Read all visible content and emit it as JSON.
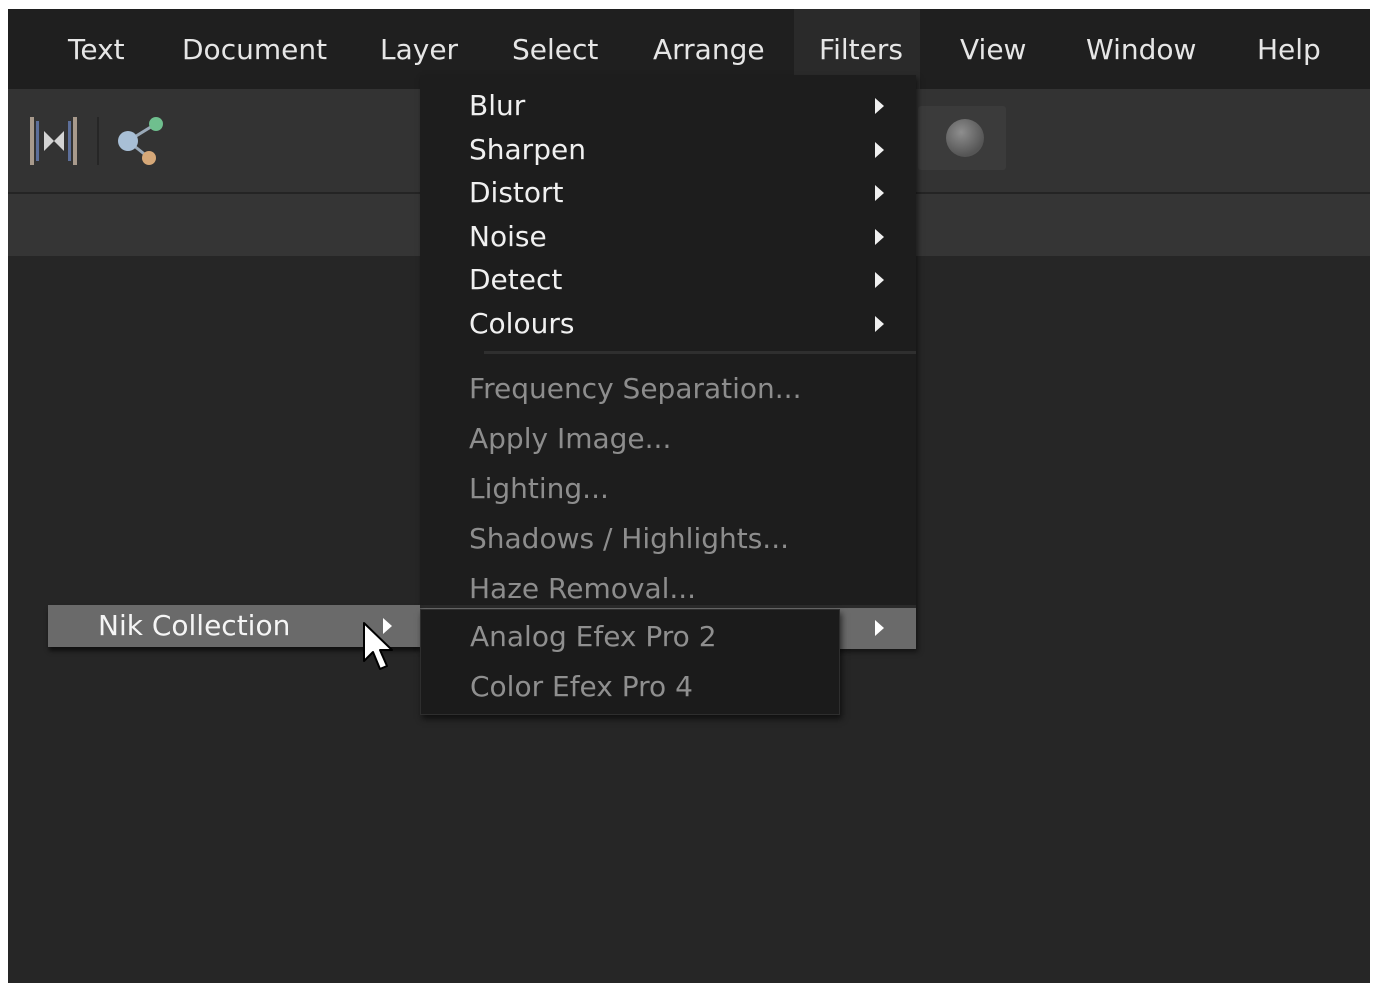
{
  "menubar": {
    "items": [
      "Text",
      "Document",
      "Layer",
      "Select",
      "Arrange",
      "Filters",
      "View",
      "Window",
      "Help"
    ],
    "active": "Filters"
  },
  "toolbar": {
    "icons": [
      "align-distribute-icon",
      "share-nodes-icon",
      "sphere-icon"
    ]
  },
  "filters_menu": {
    "submenus": [
      "Blur",
      "Sharpen",
      "Distort",
      "Noise",
      "Detect",
      "Colours"
    ],
    "disabled_items": [
      "Frequency Separation...",
      "Apply Image...",
      "Lighting...",
      "Shadows / Highlights...",
      "Haze Removal..."
    ],
    "highlighted_item": "Nik Collection"
  },
  "nik_submenu": {
    "items": [
      "Analog Efex Pro 2",
      "Color Efex Pro 4"
    ]
  },
  "colors": {
    "background": "#262626",
    "menubar": "#1f1f1f",
    "dropdown": "#1d1d1d",
    "highlight": "#6a6a6a",
    "text_enabled": "#f0f0f0",
    "text_disabled": "#8d8d8d"
  }
}
